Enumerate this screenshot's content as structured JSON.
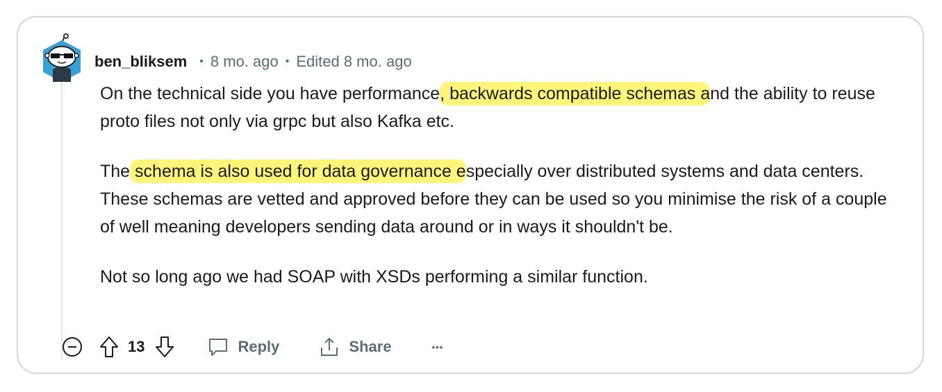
{
  "comment": {
    "username": "ben_bliksem",
    "posted": "8 mo. ago",
    "edited": "Edited 8 mo. ago",
    "separator": "•",
    "paragraphs": [
      {
        "segments": [
          {
            "text": "On the technical side you have performance",
            "highlight": false
          },
          {
            "text": ", backwards compatible schemas a",
            "highlight": true
          },
          {
            "text": "nd the ability to reuse proto files not only via grpc but also Kafka etc.",
            "highlight": false
          }
        ]
      },
      {
        "segments": [
          {
            "text": "The",
            "highlight": false
          },
          {
            "text": " schema is also used for data governance e",
            "highlight": true
          },
          {
            "text": "specially over distributed systems and data centers. These schemas are vetted and approved before they can be used so you minimise the risk of a couple of well meaning developers sending data around or in ways it shouldn't be.",
            "highlight": false
          }
        ]
      },
      {
        "segments": [
          {
            "text": "Not so long ago we had SOAP with XSDs performing a similar function.",
            "highlight": false
          }
        ]
      }
    ]
  },
  "actions": {
    "score": "13",
    "reply_label": "Reply",
    "share_label": "Share",
    "more_label": "•••"
  },
  "icons": {
    "avatar": "snoo-avatar-sunglasses",
    "collapse": "collapse-minus-icon",
    "upvote": "upvote-arrow-icon",
    "downvote": "downvote-arrow-icon",
    "reply": "speech-bubble-icon",
    "share": "share-upload-icon",
    "more": "more-options-icon"
  },
  "colors": {
    "highlight": "#fff57a",
    "meta_text": "#576f76",
    "border": "#d4d4d4"
  }
}
